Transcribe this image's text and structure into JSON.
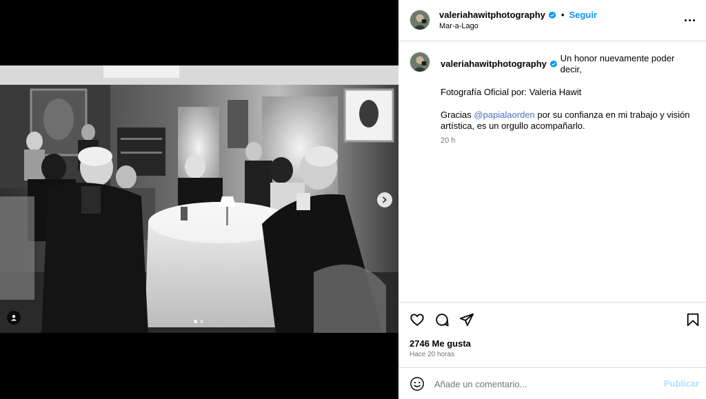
{
  "post": {
    "username": "valeriahawitphotography",
    "verified": true,
    "separator": "•",
    "follow_label": "Seguir",
    "location": "Mar-a-Lago",
    "more_icon": "more-horizontal-icon"
  },
  "caption": {
    "username": "valeriahawitphotography",
    "line1": "Un honor nuevamente poder decir,",
    "line2": "Fotografía Oficial por: Valeria Hawit",
    "line3_prefix": "Gracias ",
    "mention": "@papialaorden",
    "line3_suffix": " por su confianza en mi trabajo y visión artística, es un orgullo acompañarlo.",
    "time": "20 h"
  },
  "media": {
    "photo_description_icon": "photo-image",
    "carousel_slide_count": 2,
    "carousel_active_index": 0,
    "next_icon": "chevron-right-icon",
    "tag_icon": "user-tag-icon"
  },
  "actions": {
    "like_icon": "heart-icon",
    "comment_icon": "comment-icon",
    "share_icon": "send-icon",
    "save_icon": "bookmark-icon",
    "likes_text": "2746 Me gusta",
    "posted_ago": "Hace 20 horas"
  },
  "comment": {
    "emoji_icon": "emoji-icon",
    "placeholder": "Añade un comentario...",
    "publish_label": "Publicar"
  },
  "colors": {
    "accent": "#0095f6",
    "publish_disabled": "#b2dffc",
    "border": "#dbdbdb",
    "secondary_text": "#737373"
  }
}
